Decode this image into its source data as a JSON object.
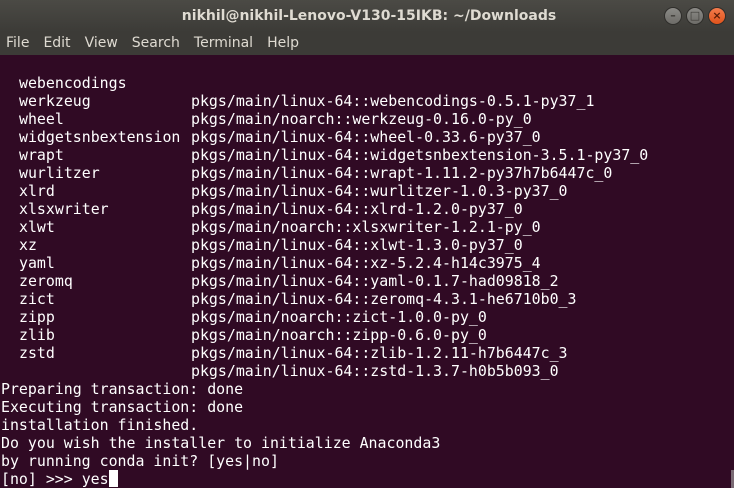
{
  "window": {
    "title": "nikhil@nikhil-Lenovo-V130-15IKB: ~/Downloads",
    "controls": [
      "minimize-icon",
      "maximize-icon",
      "close-icon"
    ],
    "control_glyphs": {
      "minimize": "–",
      "maximize": "□",
      "close": "×"
    }
  },
  "menubar": {
    "items": [
      "File",
      "Edit",
      "View",
      "Search",
      "Terminal",
      "Help"
    ]
  },
  "terminal": {
    "background": "#300a24",
    "foreground": "#ffffff",
    "packages": [
      {
        "name": "webencodings",
        "source": "pkgs/main/linux-64::webencodings-0.5.1-py37_1"
      },
      {
        "name": "werkzeug",
        "source": "pkgs/main/noarch::werkzeug-0.16.0-py_0"
      },
      {
        "name": "wheel",
        "source": "pkgs/main/linux-64::wheel-0.33.6-py37_0"
      },
      {
        "name": "widgetsnbextension",
        "source": "pkgs/main/linux-64::widgetsnbextension-3.5.1-py37_0"
      },
      {
        "name": "wrapt",
        "source": "pkgs/main/linux-64::wrapt-1.11.2-py37h7b6447c_0"
      },
      {
        "name": "wurlitzer",
        "source": "pkgs/main/linux-64::wurlitzer-1.0.3-py37_0"
      },
      {
        "name": "xlrd",
        "source": "pkgs/main/linux-64::xlrd-1.2.0-py37_0"
      },
      {
        "name": "xlsxwriter",
        "source": "pkgs/main/noarch::xlsxwriter-1.2.1-py_0"
      },
      {
        "name": "xlwt",
        "source": "pkgs/main/linux-64::xlwt-1.3.0-py37_0"
      },
      {
        "name": "xz",
        "source": "pkgs/main/linux-64::xz-5.2.4-h14c3975_4"
      },
      {
        "name": "yaml",
        "source": "pkgs/main/linux-64::yaml-0.1.7-had09818_2"
      },
      {
        "name": "zeromq",
        "source": "pkgs/main/linux-64::zeromq-4.3.1-he6710b0_3"
      },
      {
        "name": "zict",
        "source": "pkgs/main/noarch::zict-1.0.0-py_0"
      },
      {
        "name": "zipp",
        "source": "pkgs/main/noarch::zipp-0.6.0-py_0"
      },
      {
        "name": "zlib",
        "source": "pkgs/main/linux-64::zlib-1.2.11-h7b6447c_3"
      },
      {
        "name": "zstd",
        "source": "pkgs/main/linux-64::zstd-1.3.7-h0b5b093_0"
      }
    ],
    "messages": [
      "Preparing transaction: done",
      "Executing transaction: done",
      "installation finished.",
      "Do you wish the installer to initialize Anaconda3",
      "by running conda init? [yes|no]"
    ],
    "prompt": "[no] >>> ",
    "input": "yes"
  }
}
